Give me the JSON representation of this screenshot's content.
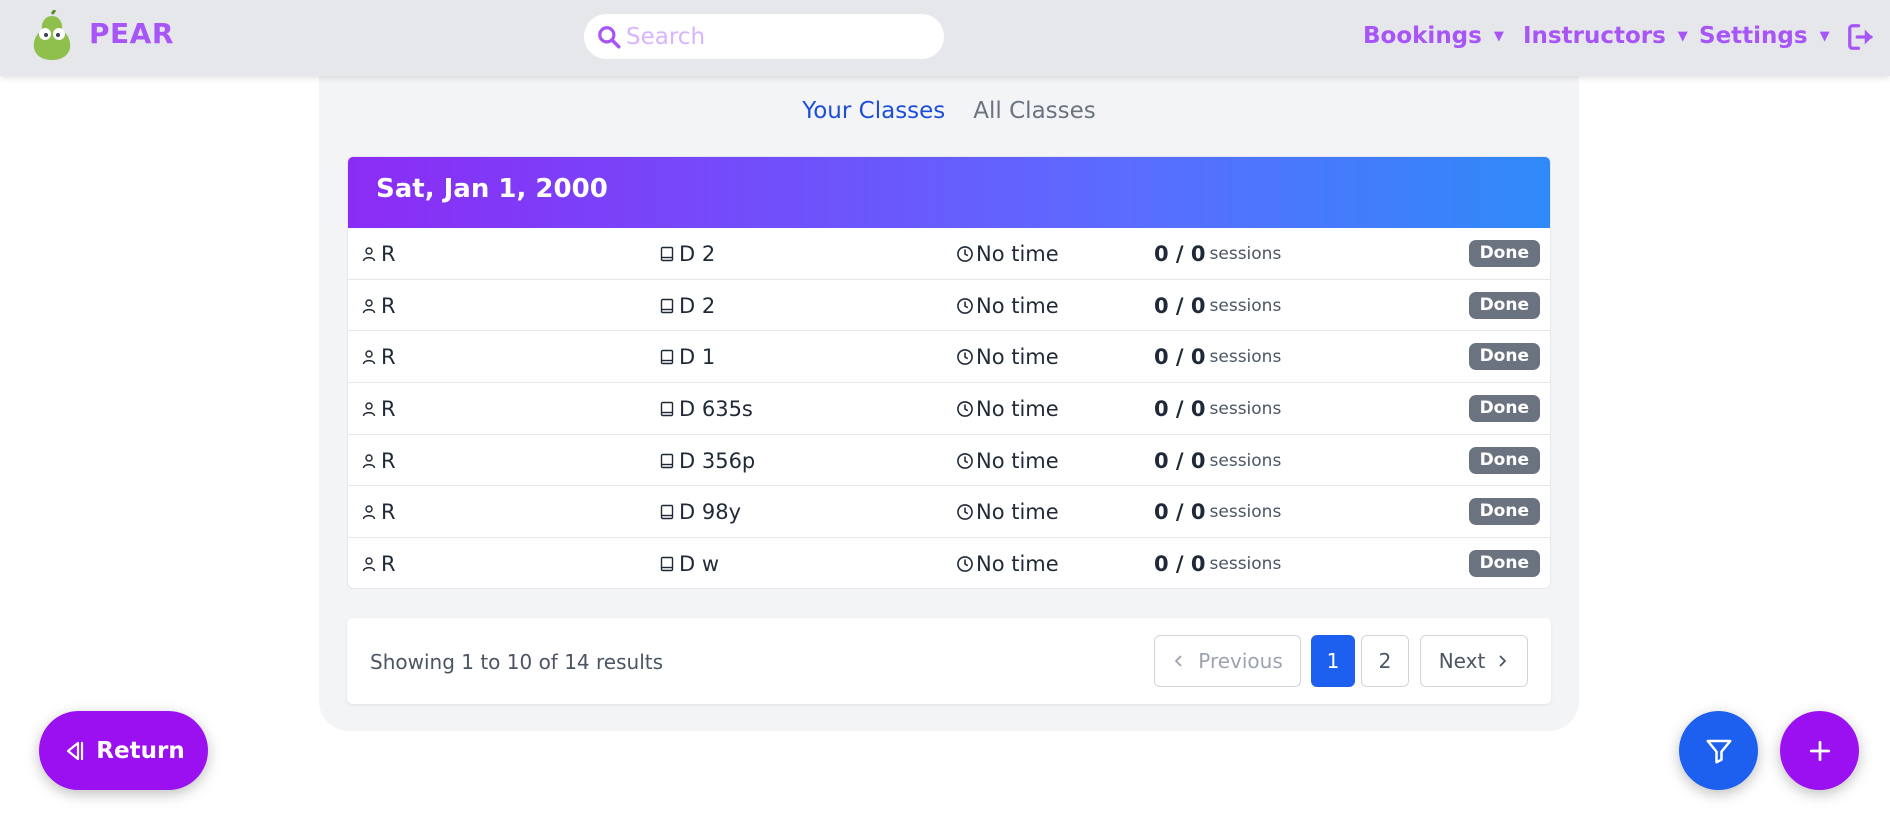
{
  "app": {
    "brand": "PEAR"
  },
  "navbar": {
    "search_placeholder": "Search",
    "menus": [
      {
        "label": "Bookings"
      },
      {
        "label": "Instructors"
      },
      {
        "label": "Settings"
      }
    ]
  },
  "tabs": [
    {
      "label": "Your Classes",
      "active": true
    },
    {
      "label": "All Classes",
      "active": false
    }
  ],
  "day": {
    "date": "Sat, Jan 1, 2000",
    "rows": [
      {
        "user": "R",
        "book": "D 2",
        "time": "No time",
        "sessions": "0 / 0",
        "sessions_label": "sessions",
        "status": "Done"
      },
      {
        "user": "R",
        "book": "D 2",
        "time": "No time",
        "sessions": "0 / 0",
        "sessions_label": "sessions",
        "status": "Done"
      },
      {
        "user": "R",
        "book": "D 1",
        "time": "No time",
        "sessions": "0 / 0",
        "sessions_label": "sessions",
        "status": "Done"
      },
      {
        "user": "R",
        "book": "D 635s",
        "time": "No time",
        "sessions": "0 / 0",
        "sessions_label": "sessions",
        "status": "Done"
      },
      {
        "user": "R",
        "book": "D 356p",
        "time": "No time",
        "sessions": "0 / 0",
        "sessions_label": "sessions",
        "status": "Done"
      },
      {
        "user": "R",
        "book": "D 98y",
        "time": "No time",
        "sessions": "0 / 0",
        "sessions_label": "sessions",
        "status": "Done"
      },
      {
        "user": "R",
        "book": "D w",
        "time": "No time",
        "sessions": "0 / 0",
        "sessions_label": "sessions",
        "status": "Done"
      }
    ]
  },
  "pagination": {
    "summary": "Showing 1 to 10 of 14 results",
    "previous": "Previous",
    "pages": [
      "1",
      "2"
    ],
    "current_page": "1",
    "next": "Next"
  },
  "actions": {
    "return_label": "Return"
  },
  "colors": {
    "accent_purple": "#a855f7",
    "primary_blue": "#1d5fef",
    "fab_purple": "#9b10f0",
    "badge_gray": "#6b7280"
  }
}
